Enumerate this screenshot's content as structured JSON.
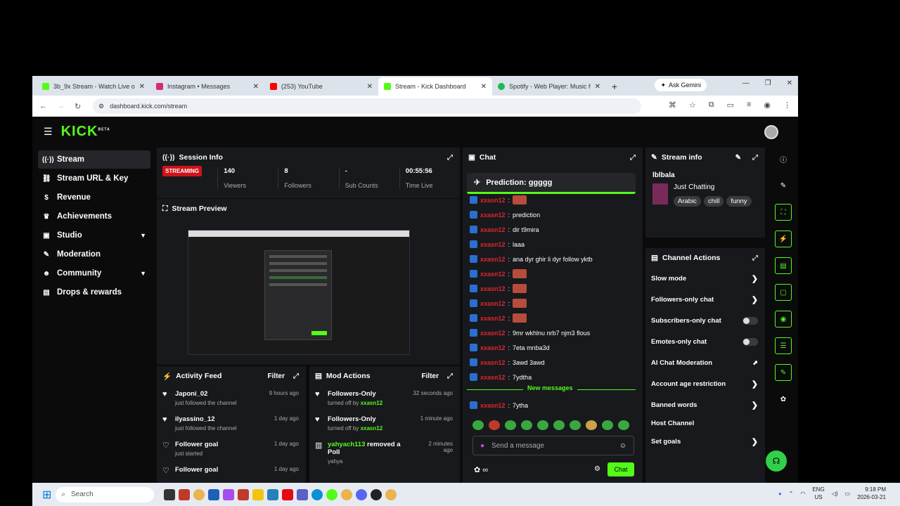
{
  "browser": {
    "tabs": [
      {
        "title": "3b_9x Stream - Watch Live on K",
        "color": "#53fc18"
      },
      {
        "title": "Instagram • Messages",
        "color": "#d62976"
      },
      {
        "title": "(253) YouTube",
        "color": "#ff0000"
      },
      {
        "title": "Stream - Kick Dashboard",
        "color": "#53fc18",
        "active": true
      },
      {
        "title": "Spotify - Web Player: Music for",
        "color": "#1db954"
      }
    ],
    "new_tab": "+",
    "gemini_label": "Ask Gemini",
    "url": "dashboard.kick.com/stream"
  },
  "app": {
    "logo": "KICK",
    "logo_badge": "BETA"
  },
  "sidebar": {
    "items": [
      {
        "label": "Stream",
        "icon": "broadcast-icon",
        "glyph": "((·))",
        "active": true
      },
      {
        "label": "Stream URL & Key",
        "icon": "link-icon",
        "glyph": "🔗"
      },
      {
        "label": "Revenue",
        "icon": "dollar-icon",
        "glyph": "$"
      },
      {
        "label": "Achievements",
        "icon": "trophy-icon",
        "glyph": "🏆"
      },
      {
        "label": "Studio",
        "icon": "studio-icon",
        "glyph": "▣",
        "chevron": true
      },
      {
        "label": "Moderation",
        "icon": "wrench-icon",
        "glyph": "🔧"
      },
      {
        "label": "Community",
        "icon": "community-icon",
        "glyph": "👥",
        "chevron": true
      },
      {
        "label": "Drops & rewards",
        "icon": "gift-icon",
        "glyph": "🎁"
      }
    ]
  },
  "session": {
    "title": "Session Info",
    "status": "STREAMING",
    "stats": [
      {
        "value": "140",
        "label": "Viewers"
      },
      {
        "value": "8",
        "label": "Followers"
      },
      {
        "value": "-",
        "label": "Sub Counts"
      },
      {
        "value": "00:55:56",
        "label": "Time Live"
      }
    ]
  },
  "preview": {
    "title": "Stream Preview"
  },
  "activity": {
    "title": "Activity Feed",
    "filter": "Filter",
    "items": [
      {
        "who": "Japoni_02",
        "what": "just followed the channel",
        "when": "9 hours ago",
        "icon": "heart-icon",
        "glyph": "♥"
      },
      {
        "who": "ilyassino_12",
        "what": "just followed the channel",
        "when": "1 day ago",
        "icon": "heart-icon",
        "glyph": "♥"
      },
      {
        "who": "Follower goal",
        "what": "just started",
        "when": "1 day ago",
        "icon": "heart-outline-icon",
        "glyph": "♡"
      },
      {
        "who": "Follower goal",
        "what": "",
        "when": "1 day ago",
        "icon": "heart-outline-icon",
        "glyph": "♡"
      }
    ]
  },
  "mod": {
    "title": "Mod Actions",
    "filter": "Filter",
    "items": [
      {
        "who": "Followers-Only",
        "what": "turned off by",
        "by": "xxasn12",
        "when": "32 seconds ago",
        "glyph": "♥"
      },
      {
        "who": "Followers-Only",
        "what": "turned off by",
        "by": "xxasn12",
        "when": "1 minute ago",
        "glyph": "♥"
      },
      {
        "who": "yahyach113",
        "suffix": "removed a Poll",
        "what": "yahya",
        "by": "",
        "when": "2 minutes ago",
        "glyph": "▥"
      }
    ]
  },
  "chat": {
    "title": "Chat",
    "prediction": "Prediction: ggggg",
    "user": "xxasn12",
    "messages": [
      {
        "text": "",
        "emote": true
      },
      {
        "text": "prediction"
      },
      {
        "text": "dir t9mira"
      },
      {
        "text": "laaa"
      },
      {
        "text": "ana dyr ghir li dyr follow yktb"
      },
      {
        "text": "",
        "emote": true
      },
      {
        "text": "",
        "emote": true
      },
      {
        "text": "",
        "emote": true
      },
      {
        "text": "",
        "emote": true
      },
      {
        "text": "9mr wkhlnu nrb7 njm3 flous"
      },
      {
        "text": "7eta mnba3d"
      },
      {
        "text": "3awd 3awd"
      },
      {
        "text": "7ydtha"
      }
    ],
    "new_messages": "New messages",
    "last_message": "7ytha",
    "placeholder": "Send a message",
    "send_label": "Chat"
  },
  "stream_info": {
    "title": "Stream info",
    "channel": "lblbala",
    "category": "Just Chatting",
    "tags": [
      "Arabic",
      "chill",
      "funny"
    ]
  },
  "channel_actions": {
    "title": "Channel Actions",
    "items": [
      {
        "label": "Slow mode",
        "control": "arrow"
      },
      {
        "label": "Followers-only chat",
        "control": "arrow"
      },
      {
        "label": "Subscribers-only chat",
        "control": "toggle"
      },
      {
        "label": "Emotes-only chat",
        "control": "toggle"
      },
      {
        "label": "AI Chat Moderation",
        "control": "external"
      },
      {
        "label": "Account age restriction",
        "control": "arrow"
      },
      {
        "label": "Banned words",
        "control": "arrow"
      },
      {
        "label": "Host Channel",
        "control": "none"
      },
      {
        "label": "Set goals",
        "control": "arrow"
      }
    ]
  },
  "taskbar": {
    "search": "Search",
    "lang_top": "ENG",
    "lang_bottom": "US",
    "time": "9:18 PM",
    "date": "2026-03-21"
  }
}
